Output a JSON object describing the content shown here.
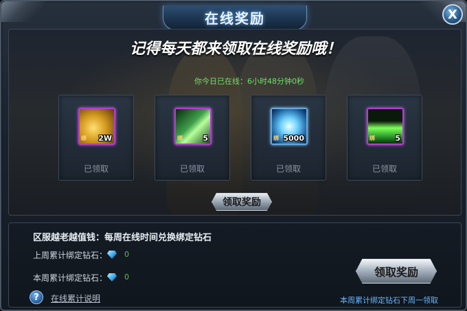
{
  "window": {
    "title": "在线奖励",
    "close_glyph": "X"
  },
  "online_panel": {
    "headline": "记得每天都来领取在线奖励哦！",
    "online_time": "你今日已在线：6小时48分钟0秒",
    "rewards": [
      {
        "icon": "gold-coins-icon",
        "quantity": "2W",
        "status": "已领取",
        "bound_mark": "绑"
      },
      {
        "icon": "green-crystal-shards-icon",
        "quantity": "5",
        "status": "已领取",
        "bound_mark": "绑"
      },
      {
        "icon": "blue-crystal-icon",
        "quantity": "5000",
        "status": "已领取",
        "bound_mark": "绑"
      },
      {
        "icon": "green-pyramid-icon",
        "quantity": "5",
        "status": "已领取",
        "bound_mark": "绑"
      }
    ],
    "claim_button": "领取奖励"
  },
  "bonus_panel": {
    "title": "区服越老越值钱：每周在线时间兑换绑定钻石",
    "last_week_label": "上周累计绑定钻石：",
    "last_week_value": "0",
    "this_week_label": "本周累计绑定钻石：",
    "this_week_value": "0",
    "help_glyph": "?",
    "help_link": "在线累计说明",
    "claim_button": "领取奖励",
    "note": "本周累计绑定钻石下周一领取"
  },
  "colors": {
    "online_time": "#6fe06a",
    "note": "#67b8ff",
    "reward_frame": "#b040c8"
  }
}
